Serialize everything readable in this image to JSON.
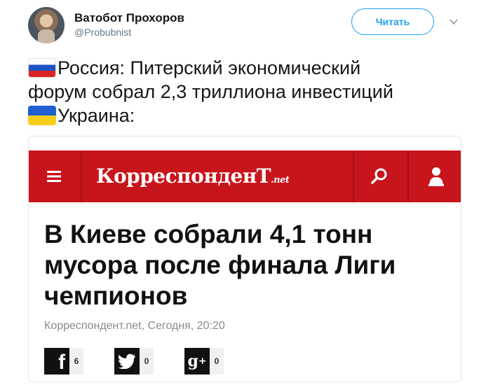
{
  "tweet": {
    "author_name": "Ватобот Прохоров",
    "author_handle": "@Probubnist",
    "follow_label": "Читать",
    "lines": [
      "Россия: Питерский экономический",
      "форум собрал 2,3 триллиона инвестиций",
      "Украина:"
    ]
  },
  "embed": {
    "site_name": "КорреспонденТ",
    "site_tld": ".net",
    "headline": "В Киеве собрали 4,1 тонн мусора после финала Лиги чемпионов",
    "meta": "Корреспондент.net, Сегодня, 20:20",
    "share": [
      {
        "icon": "facebook-icon",
        "glyph": "f",
        "count": "6"
      },
      {
        "icon": "twitter-icon",
        "glyph": "🐦",
        "count": "0"
      },
      {
        "icon": "google-plus-icon",
        "glyph": "g+",
        "count": "0"
      }
    ]
  },
  "colors": {
    "brand_red": "#c8141b",
    "twitter_blue": "#1da1f2"
  }
}
